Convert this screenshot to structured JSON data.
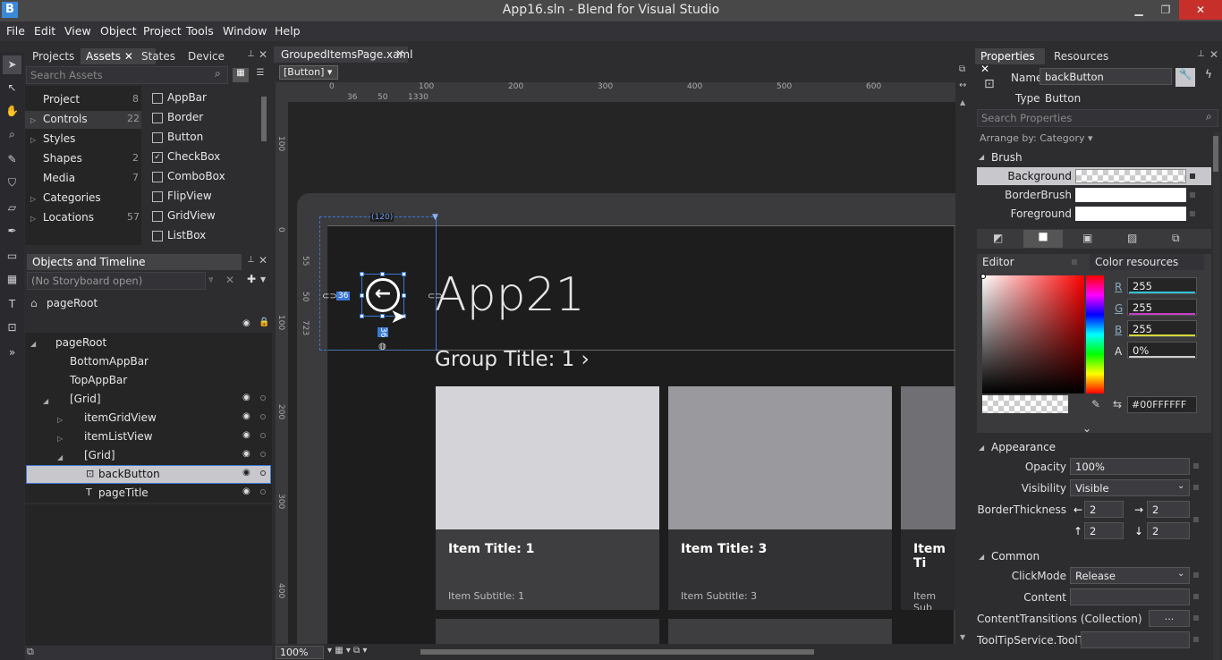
{
  "window": {
    "title": "App16.sln - Blend for Visual Studio",
    "logo": "B"
  },
  "menu": [
    "File",
    "Edit",
    "View",
    "Object",
    "Project",
    "Tools",
    "Window",
    "Help"
  ],
  "assets": {
    "tabs": [
      "Projects",
      "Assets",
      "States",
      "Device"
    ],
    "search_placeholder": "Search Assets",
    "categories": [
      {
        "label": "Project",
        "count": "8"
      },
      {
        "label": "Controls",
        "count": "22"
      },
      {
        "label": "Styles",
        "count": ""
      },
      {
        "label": "Shapes",
        "count": "2"
      },
      {
        "label": "Media",
        "count": "7"
      },
      {
        "label": "Categories",
        "count": ""
      },
      {
        "label": "Locations",
        "count": "57"
      }
    ],
    "items": [
      "AppBar",
      "Border",
      "Button",
      "CheckBox",
      "ComboBox",
      "FlipView",
      "GridView",
      "ListBox"
    ]
  },
  "objects": {
    "title": "Objects and Timeline",
    "storyboard": "(No Storyboard open)",
    "root_header": "pageRoot",
    "tree": [
      {
        "label": "pageRoot",
        "indent": 0
      },
      {
        "label": "BottomAppBar",
        "indent": 1
      },
      {
        "label": "TopAppBar",
        "indent": 1
      },
      {
        "label": "[Grid]",
        "indent": 1
      },
      {
        "label": "itemGridView",
        "indent": 2
      },
      {
        "label": "itemListView",
        "indent": 2
      },
      {
        "label": "[Grid]",
        "indent": 2
      },
      {
        "label": "backButton",
        "indent": 3
      },
      {
        "label": "pageTitle",
        "indent": 3
      }
    ]
  },
  "document": {
    "tab": "GroupedItemsPage.xaml",
    "breadcrumb": "[Button]",
    "zoom": "100%",
    "ruler_h": [
      "0",
      "100",
      "200",
      "300",
      "400",
      "500",
      "600"
    ],
    "ruler_v": [
      "100",
      "0",
      "100",
      "200",
      "300",
      "400"
    ],
    "ruler_marks": [
      "36",
      "50",
      "1330"
    ],
    "vruler_marks": [
      "55",
      "50",
      "723"
    ],
    "adorner_top": "(120)",
    "adorner_left": "36",
    "adorner_bottom": "36",
    "app_title": "App21",
    "group_title": "Group Title: 1 ›",
    "tiles": [
      {
        "title": "Item Title: 1",
        "subtitle": "Item Subtitle: 1",
        "color": "#d4d4d8"
      },
      {
        "title": "Item Title: 3",
        "subtitle": "Item Subtitle: 3",
        "color": "#9a9a9e"
      },
      {
        "title": "Item Ti",
        "subtitle": "Item Sub",
        "color": "#707074"
      }
    ]
  },
  "properties": {
    "tabs": [
      "Properties",
      "Resources"
    ],
    "name_label": "Name",
    "name_value": "backButton",
    "type_label": "Type",
    "type_value": "Button",
    "search_placeholder": "Search Properties",
    "arrange": "Arrange by: Category",
    "brush_header": "Brush",
    "brushes": [
      "Background",
      "BorderBrush",
      "Foreground"
    ],
    "editor_tab": "Editor",
    "color_resources_tab": "Color resources",
    "rgba": [
      {
        "label": "R",
        "value": "255",
        "color": "#2fc4d6"
      },
      {
        "label": "G",
        "value": "255",
        "color": "#c83cc8"
      },
      {
        "label": "B",
        "value": "255",
        "color": "#d8d838"
      },
      {
        "label": "A",
        "value": "0%",
        "color": "#cccccc"
      }
    ],
    "hex": "#00FFFFFF",
    "appearance_header": "Appearance",
    "opacity_label": "Opacity",
    "opacity_value": "100%",
    "visibility_label": "Visibility",
    "visibility_value": "Visible",
    "border_label": "BorderThickness",
    "thickness": [
      "2",
      "2",
      "2",
      "2"
    ],
    "common_header": "Common",
    "clickmode_label": "ClickMode",
    "clickmode_value": "Release",
    "content_label": "Content",
    "transitions_label": "ContentTransitions (Collection)",
    "transitions_btn": "...",
    "tooltip_label": "ToolTipService.ToolTip"
  }
}
